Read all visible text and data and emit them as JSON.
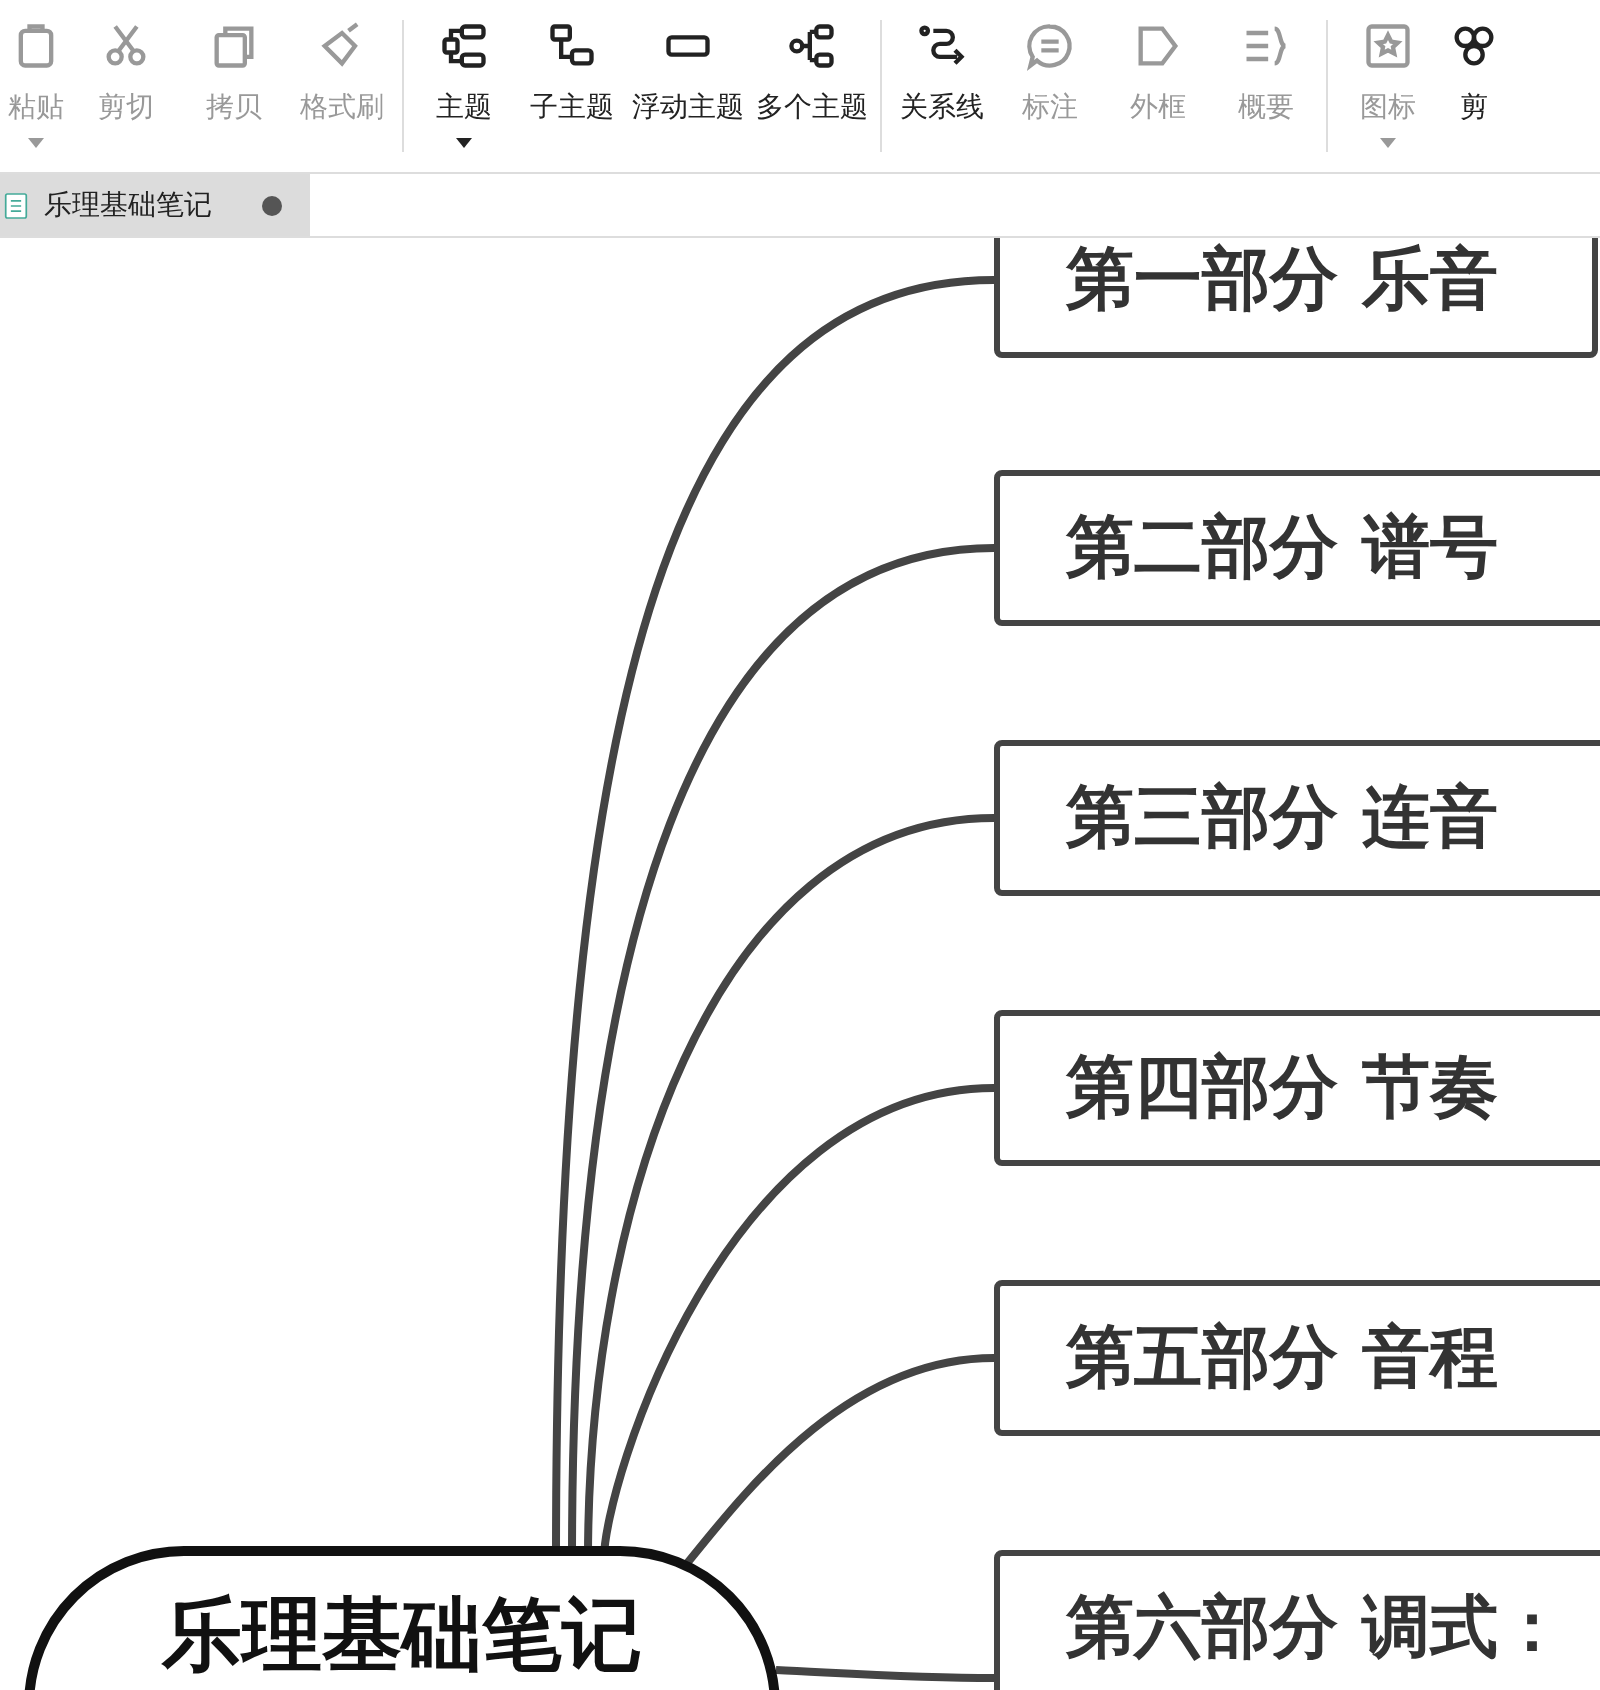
{
  "toolbar": {
    "groups": [
      {
        "items": [
          {
            "label": "粘贴",
            "disabled": true,
            "dropdown": true
          },
          {
            "label": "剪切",
            "disabled": true,
            "dropdown": false
          },
          {
            "label": "拷贝",
            "disabled": true,
            "dropdown": false
          },
          {
            "label": "格式刷",
            "disabled": true,
            "dropdown": false
          }
        ]
      },
      {
        "items": [
          {
            "label": "主题",
            "disabled": false,
            "dropdown": true
          },
          {
            "label": "子主题",
            "disabled": false,
            "dropdown": false
          },
          {
            "label": "浮动主题",
            "disabled": false,
            "dropdown": false
          },
          {
            "label": "多个主题",
            "disabled": false,
            "dropdown": false
          }
        ]
      },
      {
        "items": [
          {
            "label": "关系线",
            "disabled": false,
            "dropdown": false
          },
          {
            "label": "标注",
            "disabled": true,
            "dropdown": false
          },
          {
            "label": "外框",
            "disabled": true,
            "dropdown": false
          },
          {
            "label": "概要",
            "disabled": true,
            "dropdown": false
          }
        ]
      },
      {
        "items": [
          {
            "label": "图标",
            "disabled": true,
            "dropdown": true
          },
          {
            "label": "剪",
            "disabled": false,
            "dropdown": false
          }
        ]
      }
    ]
  },
  "tabs": [
    {
      "title": "乐理基础笔记",
      "selected": true,
      "modified": true
    }
  ],
  "mindmap": {
    "root": {
      "text": "乐理基础笔记"
    },
    "topics": [
      {
        "text": "第一部分 乐音"
      },
      {
        "text": "第二部分  谱号"
      },
      {
        "text": "第三部分 连音"
      },
      {
        "text": "第四部分 节奏"
      },
      {
        "text": "第五部分 音程"
      },
      {
        "text": "第六部分  调式："
      }
    ]
  }
}
